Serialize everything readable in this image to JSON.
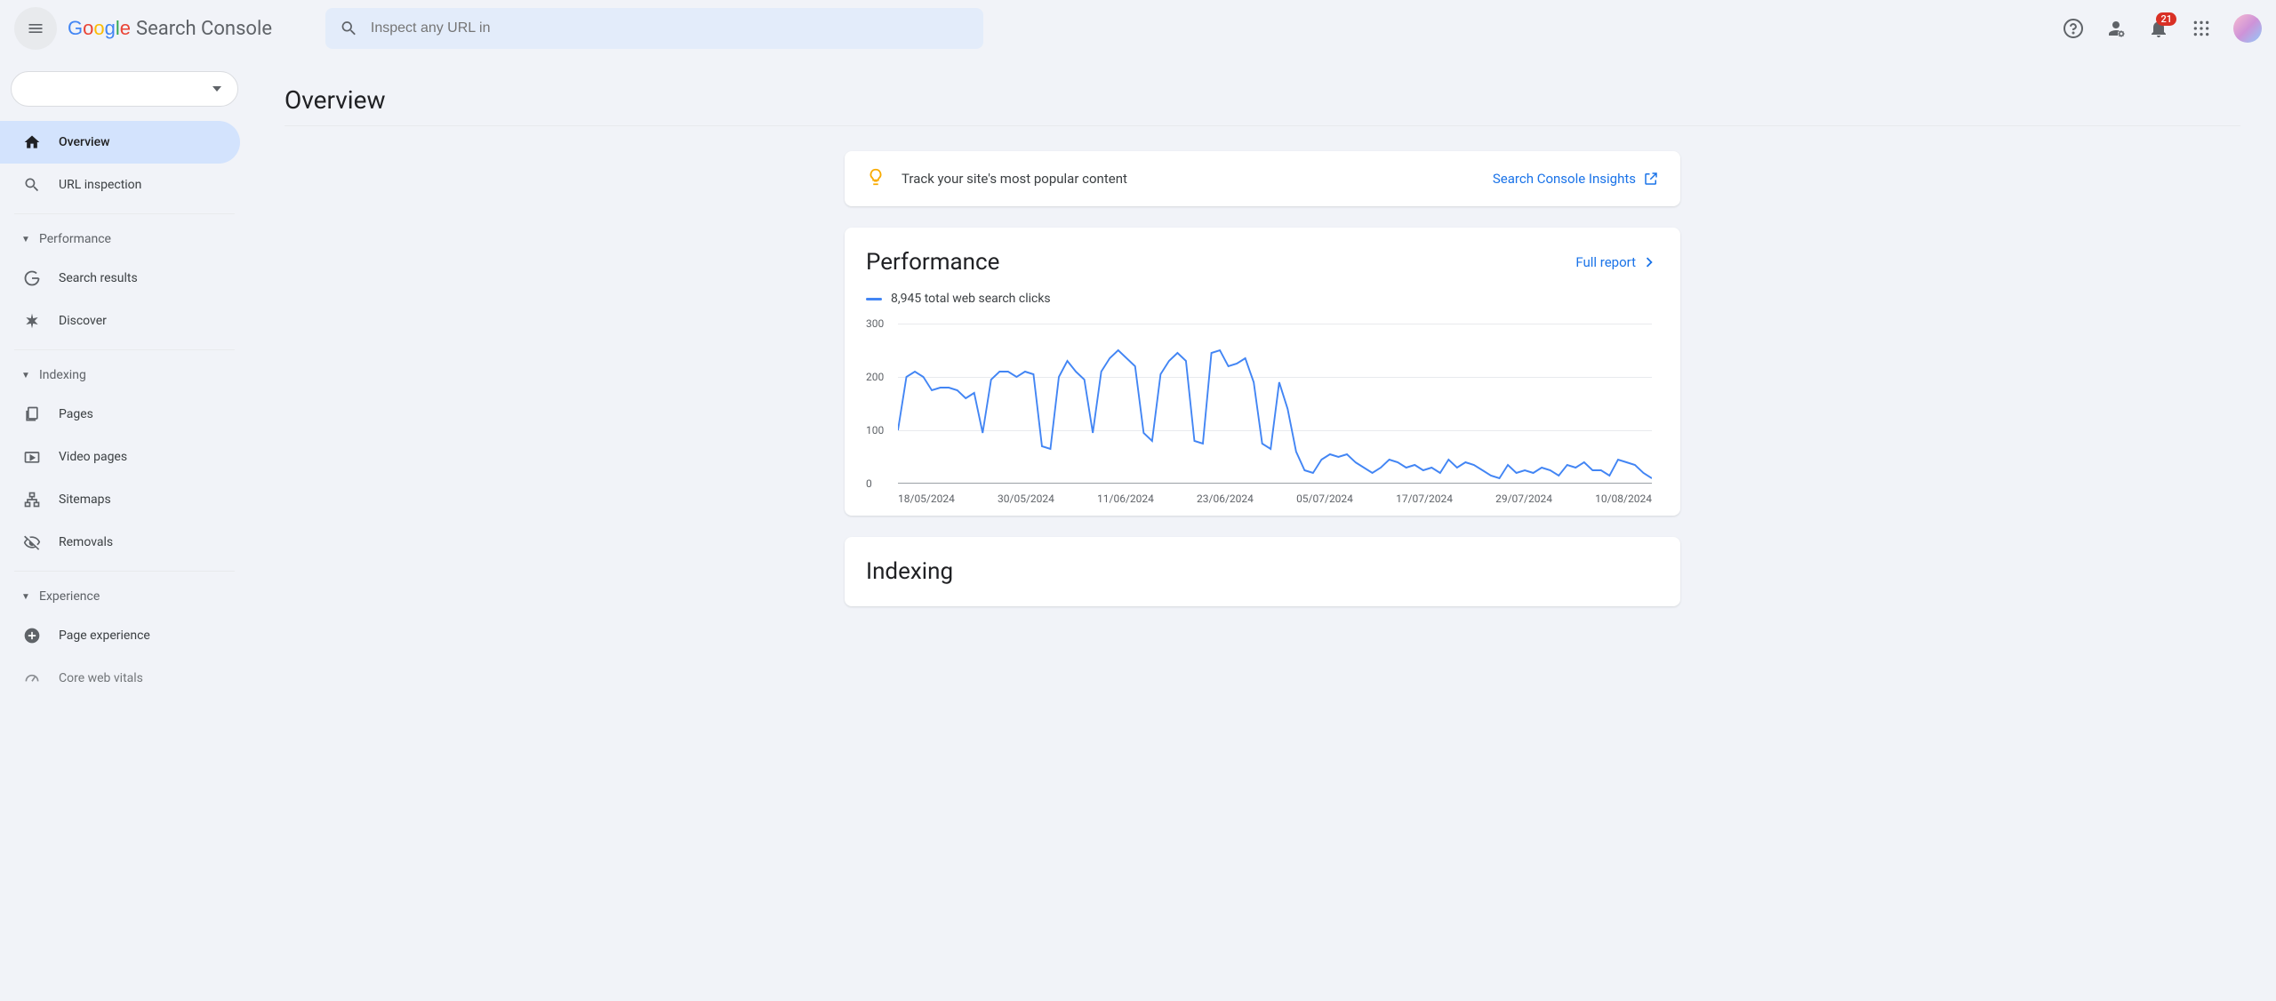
{
  "app_name": "Search Console",
  "search_placeholder": "Inspect any URL in",
  "notification_count": "21",
  "page_title": "Overview",
  "sidebar": {
    "items": {
      "overview": "Overview",
      "url_inspection": "URL inspection"
    },
    "performance_section": "Performance",
    "perf_items": {
      "search_results": "Search results",
      "discover": "Discover"
    },
    "indexing_section": "Indexing",
    "index_items": {
      "pages": "Pages",
      "video_pages": "Video pages",
      "sitemaps": "Sitemaps",
      "removals": "Removals"
    },
    "experience_section": "Experience",
    "exp_items": {
      "page_experience": "Page experience",
      "core_web_vitals": "Core web vitals"
    }
  },
  "insights": {
    "text": "Track your site's most popular content",
    "link": "Search Console Insights"
  },
  "performance_card": {
    "title": "Performance",
    "full_report": "Full report",
    "legend": "8,945 total web search clicks",
    "y_ticks": [
      "300",
      "200",
      "100",
      "0"
    ],
    "x_ticks": [
      "18/05/2024",
      "30/05/2024",
      "11/06/2024",
      "23/06/2024",
      "05/07/2024",
      "17/07/2024",
      "29/07/2024",
      "10/08/2024"
    ]
  },
  "indexing_card": {
    "title": "Indexing"
  },
  "chart_data": {
    "type": "line",
    "title": "Performance",
    "ylabel": "total web search clicks",
    "xlabel": "",
    "ylim": [
      0,
      300
    ],
    "total_clicks": 8945,
    "series": [
      {
        "name": "web search clicks",
        "color": "#4285f4",
        "x": [
          "18/05/2024",
          "19/05/2024",
          "20/05/2024",
          "21/05/2024",
          "22/05/2024",
          "23/05/2024",
          "24/05/2024",
          "25/05/2024",
          "26/05/2024",
          "27/05/2024",
          "28/05/2024",
          "29/05/2024",
          "30/05/2024",
          "31/05/2024",
          "01/06/2024",
          "02/06/2024",
          "03/06/2024",
          "04/06/2024",
          "05/06/2024",
          "06/06/2024",
          "07/06/2024",
          "08/06/2024",
          "09/06/2024",
          "10/06/2024",
          "11/06/2024",
          "12/06/2024",
          "13/06/2024",
          "14/06/2024",
          "15/06/2024",
          "16/06/2024",
          "17/06/2024",
          "18/06/2024",
          "19/06/2024",
          "20/06/2024",
          "21/06/2024",
          "22/06/2024",
          "23/06/2024",
          "24/06/2024",
          "25/06/2024",
          "26/06/2024",
          "27/06/2024",
          "28/06/2024",
          "29/06/2024",
          "30/06/2024",
          "01/07/2024",
          "02/07/2024",
          "03/07/2024",
          "04/07/2024",
          "05/07/2024",
          "06/07/2024",
          "07/07/2024",
          "08/07/2024",
          "09/07/2024",
          "10/07/2024",
          "11/07/2024",
          "12/07/2024",
          "13/07/2024",
          "14/07/2024",
          "15/07/2024",
          "16/07/2024",
          "17/07/2024",
          "18/07/2024",
          "19/07/2024",
          "20/07/2024",
          "21/07/2024",
          "22/07/2024",
          "23/07/2024",
          "24/07/2024",
          "25/07/2024",
          "26/07/2024",
          "27/07/2024",
          "28/07/2024",
          "29/07/2024",
          "30/07/2024",
          "31/07/2024",
          "01/08/2024",
          "02/08/2024",
          "03/08/2024",
          "04/08/2024",
          "05/08/2024",
          "06/08/2024",
          "07/08/2024",
          "08/08/2024",
          "09/08/2024",
          "10/08/2024",
          "11/08/2024",
          "12/08/2024",
          "13/08/2024",
          "14/08/2024",
          "15/08/2024"
        ],
        "values": [
          100,
          200,
          210,
          200,
          175,
          180,
          180,
          175,
          160,
          170,
          95,
          195,
          210,
          210,
          200,
          210,
          205,
          70,
          65,
          200,
          230,
          210,
          195,
          95,
          210,
          235,
          250,
          235,
          220,
          95,
          80,
          205,
          230,
          245,
          230,
          80,
          75,
          245,
          250,
          220,
          225,
          235,
          190,
          75,
          65,
          190,
          140,
          60,
          25,
          20,
          45,
          55,
          50,
          55,
          40,
          30,
          20,
          30,
          45,
          40,
          30,
          35,
          25,
          30,
          20,
          45,
          30,
          40,
          35,
          25,
          15,
          10,
          35,
          20,
          25,
          20,
          30,
          25,
          15,
          35,
          30,
          40,
          25,
          25,
          15,
          45,
          40,
          35,
          20,
          10
        ]
      }
    ]
  }
}
